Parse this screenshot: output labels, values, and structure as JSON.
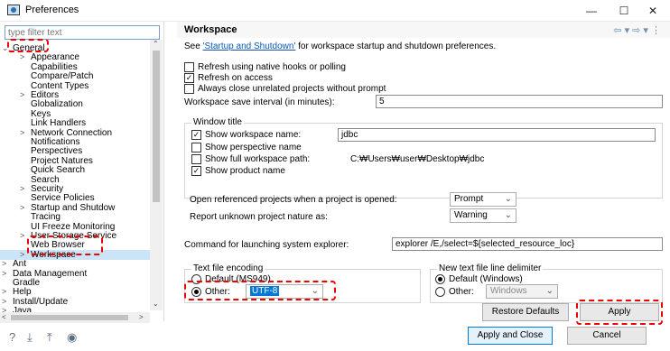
{
  "window": {
    "title": "Preferences",
    "minimize": "—",
    "maximize": "☐",
    "close": "✕"
  },
  "filter": {
    "placeholder": "type filter text"
  },
  "tree": {
    "items": [
      {
        "label": "General",
        "arrow": "⌄",
        "level": 0
      },
      {
        "label": "Appearance",
        "arrow": ">",
        "level": 1
      },
      {
        "label": "Capabilities",
        "arrow": "",
        "level": 1
      },
      {
        "label": "Compare/Patch",
        "arrow": "",
        "level": 1
      },
      {
        "label": "Content Types",
        "arrow": "",
        "level": 1
      },
      {
        "label": "Editors",
        "arrow": ">",
        "level": 1
      },
      {
        "label": "Globalization",
        "arrow": "",
        "level": 1
      },
      {
        "label": "Keys",
        "arrow": "",
        "level": 1
      },
      {
        "label": "Link Handlers",
        "arrow": "",
        "level": 1
      },
      {
        "label": "Network Connection",
        "arrow": ">",
        "level": 1
      },
      {
        "label": "Notifications",
        "arrow": "",
        "level": 1
      },
      {
        "label": "Perspectives",
        "arrow": "",
        "level": 1
      },
      {
        "label": "Project Natures",
        "arrow": "",
        "level": 1
      },
      {
        "label": "Quick Search",
        "arrow": "",
        "level": 1
      },
      {
        "label": "Search",
        "arrow": "",
        "level": 1
      },
      {
        "label": "Security",
        "arrow": ">",
        "level": 1
      },
      {
        "label": "Service Policies",
        "arrow": "",
        "level": 1
      },
      {
        "label": "Startup and Shutdow",
        "arrow": ">",
        "level": 1
      },
      {
        "label": "Tracing",
        "arrow": "",
        "level": 1
      },
      {
        "label": "UI Freeze Monitoring",
        "arrow": "",
        "level": 1
      },
      {
        "label": "User Storage Service",
        "arrow": ">",
        "level": 1
      },
      {
        "label": "Web Browser",
        "arrow": "",
        "level": 1
      },
      {
        "label": "Workspace",
        "arrow": ">",
        "level": 1
      },
      {
        "label": "Ant",
        "arrow": ">",
        "level": 0
      },
      {
        "label": "Data Management",
        "arrow": ">",
        "level": 0
      },
      {
        "label": "Gradle",
        "arrow": "",
        "level": 0
      },
      {
        "label": "Help",
        "arrow": ">",
        "level": 0
      },
      {
        "label": "Install/Update",
        "arrow": ">",
        "level": 0
      },
      {
        "label": "Java",
        "arrow": ">",
        "level": 0
      }
    ]
  },
  "page": {
    "title": "Workspace",
    "nav_icons": "⇦ ▾ ⇨ ▾ ⋮",
    "intro_prefix": "See ",
    "intro_link": "'Startup and Shutdown'",
    "intro_suffix": " for workspace startup and shutdown preferences.",
    "refresh_native": {
      "label": "Refresh using native hooks or polling",
      "checked": false
    },
    "refresh_access": {
      "label": "Refresh on access",
      "checked": true
    },
    "always_close": {
      "label": "Always close unrelated projects without prompt",
      "checked": false
    },
    "save_interval_label": "Workspace save interval (in minutes):",
    "save_interval_value": "5",
    "window_title": {
      "group_label": "Window title",
      "show_workspace_name": {
        "label": "Show workspace name:",
        "checked": true,
        "value": "jdbc"
      },
      "show_perspective_name": {
        "label": "Show perspective name",
        "checked": false
      },
      "show_full_path": {
        "label": "Show full workspace path:",
        "checked": false,
        "value": "C:₩Users₩user₩Desktop₩jdbc"
      },
      "show_product_name": {
        "label": "Show product name",
        "checked": true
      }
    },
    "open_referenced_label": "Open referenced projects when a project is opened:",
    "open_referenced_value": "Prompt",
    "report_unknown_label": "Report unknown project nature as:",
    "report_unknown_value": "Warning",
    "explorer_label": "Command for launching system explorer:",
    "explorer_value": "explorer /E,/select=${selected_resource_loc}",
    "encoding": {
      "group_label": "Text file encoding",
      "default_label": "Default (MS949)",
      "other_label": "Other:",
      "other_value": "UTF-8"
    },
    "delimiter": {
      "group_label": "New text file line delimiter",
      "default_label": "Default (Windows)",
      "other_label": "Other:",
      "other_value": "Windows"
    },
    "restore_defaults": "Restore Defaults",
    "apply": "Apply"
  },
  "footer": {
    "apply_and_close": "Apply and Close",
    "cancel": "Cancel"
  },
  "colors": {
    "highlight_red": "#e00000",
    "link": "#0b56b4",
    "selection": "#cce4f7",
    "primary_border": "#0078d7"
  }
}
